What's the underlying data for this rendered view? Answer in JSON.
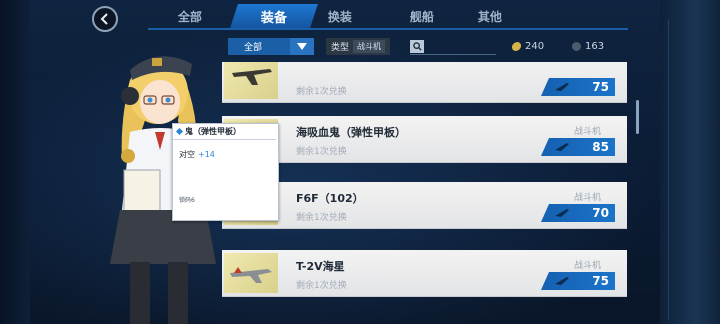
{
  "tabs": [
    {
      "label": "全部"
    },
    {
      "label": "装备",
      "active": true
    },
    {
      "label": "换装"
    },
    {
      "label": "舰船"
    },
    {
      "label": "其他"
    }
  ],
  "filter": {
    "category_value": "全部",
    "type_label": "类型",
    "type_value": "战斗机"
  },
  "currencies": {
    "coin_a": "240",
    "coin_b": "163"
  },
  "items": [
    {
      "name": "",
      "sub": "剩余1次兑换",
      "category": "",
      "price": "75"
    },
    {
      "name": "海吸血鬼（弹性甲板）",
      "sub": "剩余1次兑换",
      "category": "战斗机",
      "price": "85"
    },
    {
      "name": "F6F（102）",
      "sub": "剩余1次兑换",
      "category": "战斗机",
      "price": "70"
    },
    {
      "name": "T-2V海星",
      "sub": "剩余1次兑换",
      "category": "战斗机",
      "price": "75"
    }
  ],
  "tooltip": {
    "title": "鬼（弹性甲板）",
    "stat_label": "对空",
    "stat_value": "+14",
    "footer": "锁码6"
  },
  "colors": {
    "accent": "#1b6fc6",
    "price_bg": "#1560b1",
    "item_bg": "#efefef"
  }
}
